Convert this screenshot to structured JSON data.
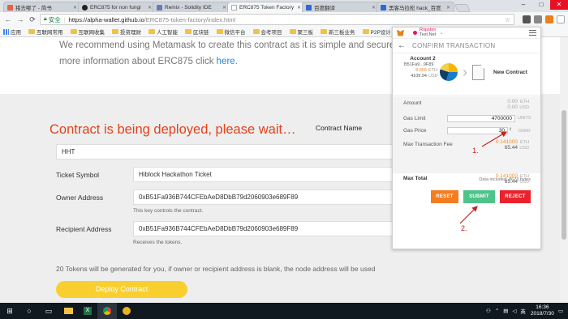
{
  "tabs": [
    {
      "label": "猪去哪了 - 简书",
      "color": "#e6604a",
      "active": false
    },
    {
      "label": "ERC875 for non fungi",
      "color": "#222",
      "active": false
    },
    {
      "label": "Remix - Solidity IDE",
      "color": "#6b7bb2",
      "active": false
    },
    {
      "label": "ERC875 Token Factory",
      "color": "#e6604a",
      "active": true
    },
    {
      "label": "百度翻译",
      "color": "#3068d6",
      "active": false
    },
    {
      "label": "黑客马拉松 hack_百度",
      "color": "#3068d6",
      "active": false
    }
  ],
  "address": {
    "secure_label": "安全",
    "separator": "|",
    "host": "https://alpha-wallet.github.io",
    "path": "/ERC875-token-factory/index.html"
  },
  "bookmarks": [
    "应用",
    "互联网常用",
    "互联网收集",
    "投资理财",
    "人工智能",
    "区块链",
    "微信平台",
    "会考项目",
    "聚三板",
    "新三板业务",
    "P2P设计"
  ],
  "page": {
    "intro_line1": "We recommend using Metamask to create this contract as it is simple and secure, you ca",
    "intro_line2": "more information about ERC875 click ",
    "intro_link": "here",
    "intro_end": ".",
    "deploying": "Contract is being deployed, please wait…",
    "contract_name_label": "Contract Name",
    "contract_name_value": "HHT",
    "ticket_symbol_label": "Ticket Symbol",
    "ticket_symbol_value": "Hiblock Hackathon Ticket",
    "owner_label": "Owner Address",
    "owner_value": "0xB51Fa936B744CFEbAeD8DbB79d2060903e689F89",
    "owner_hint": "This key controls the contract.",
    "recipient_label": "Recipient Address",
    "recipient_value": "0xB51Fa936B744CFEbAeD8DbB79d2060903e689F89",
    "recipient_hint": "Receives the tokens.",
    "note": "20 Tokens will be generated for you, if owner or recipient address is blank, the node address will be used",
    "deploy_button": "Deploy Contract"
  },
  "metamask": {
    "network_line1": "Ropsten",
    "network_line2": "Test Net",
    "title": "CONFIRM TRANSACTION",
    "account_name": "Account 2",
    "account_addr": "B51Fa9...9F89",
    "balance_eth": "8.855",
    "balance_eth_unit": "ETH",
    "balance_usd": "4109.94",
    "balance_usd_unit": "USD",
    "target": "New Contract",
    "amount_label": "Amount",
    "amount_eth": "0.00",
    "amount_eth_unit": "ETH",
    "amount_usd": "0.00",
    "amount_usd_unit": "USD",
    "gas_limit_label": "Gas Limit",
    "gas_limit_value": "4700000",
    "gas_limit_unit": "UNITS",
    "gas_price_label": "Gas Price",
    "gas_price_value": "30",
    "gas_price_unit": "GWEI",
    "max_fee_label": "Max Transaction Fee",
    "max_fee_eth": "0.141000",
    "max_fee_eth_unit": "ETH",
    "max_fee_usd": "65.44",
    "max_fee_usd_unit": "USD",
    "max_total_label": "Max Total",
    "max_total_eth": "0.141000",
    "max_total_eth_unit": "ETH",
    "max_total_usd": "65.44",
    "max_total_usd_unit": "USD",
    "data_included": "Data included: 8673 bytes",
    "reset": "RESET",
    "submit": "SUBMIT",
    "reject": "REJECT"
  },
  "annotations": {
    "one": "1.",
    "two": "2."
  },
  "taskbar": {
    "time": "16:36",
    "date": "2018/7/30",
    "ime": "英"
  },
  "colors": {
    "deploy_title": "#e2421b",
    "accent_link": "#2c7fd6",
    "deploy_button": "#f8cf2e",
    "reset": "#f57c1f",
    "submit": "#4ec38a",
    "reject": "#e9222b",
    "annotation": "#c9211d"
  }
}
